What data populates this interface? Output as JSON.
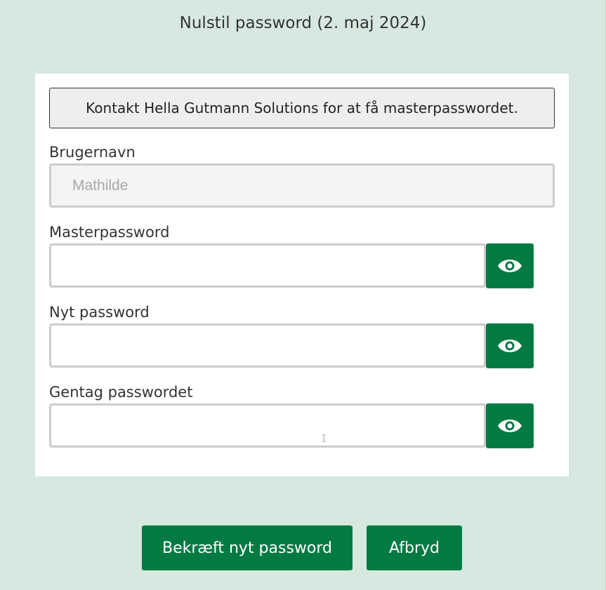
{
  "dialog": {
    "title": "Nulstil password (2. maj 2024)",
    "info": "Kontakt Hella Gutmann Solutions for at få masterpasswordet."
  },
  "fields": {
    "username": {
      "label": "Brugernavn",
      "value": "Mathilde"
    },
    "master": {
      "label": "Masterpassword",
      "value": "",
      "toggle_icon": "eye-icon"
    },
    "new_password": {
      "label": "Nyt password",
      "value": "",
      "toggle_icon": "eye-icon"
    },
    "repeat_password": {
      "label": "Gentag passwordet",
      "value": "",
      "toggle_icon": "eye-icon"
    }
  },
  "actions": {
    "confirm_label": "Bekræft nyt password",
    "cancel_label": "Afbryd"
  },
  "colors": {
    "background": "#d6e8df",
    "accent": "#047a43",
    "panel": "#ffffff"
  }
}
